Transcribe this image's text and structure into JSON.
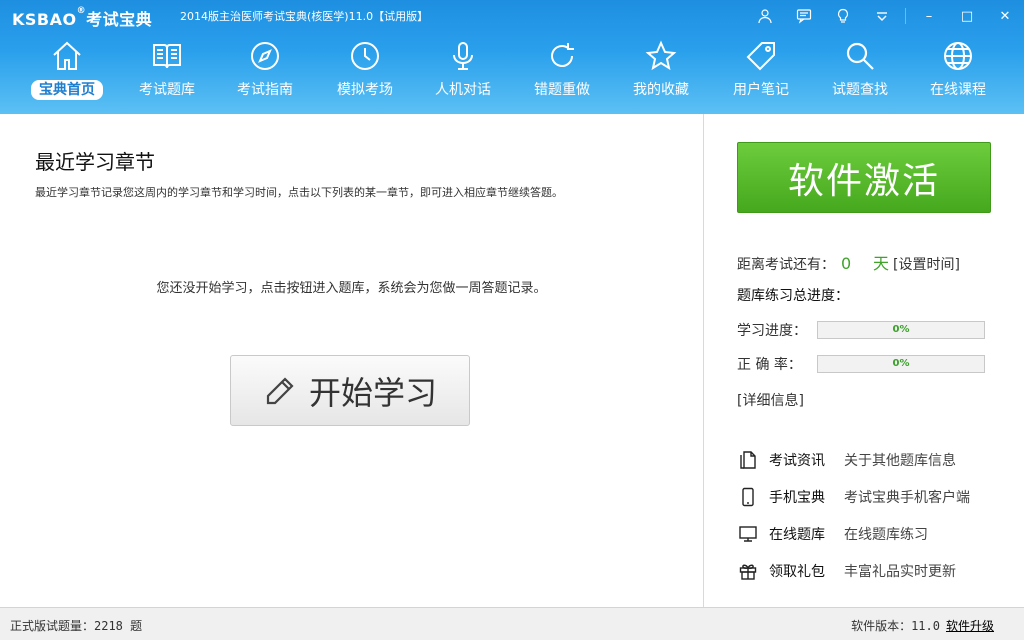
{
  "titlebar": {
    "logo_text": "KSBAO",
    "logo_reg": "®",
    "logo_cn": "考试宝典",
    "app_title": "2014版主治医师考试宝典(核医学)11.0【试用版】",
    "icons": [
      "user-icon",
      "message-icon",
      "lightbulb-icon",
      "dropdown-icon"
    ],
    "minimize": "–",
    "maximize": "□",
    "close": "✕"
  },
  "nav": {
    "items": [
      {
        "label": "宝典首页",
        "icon": "home-icon",
        "active": true
      },
      {
        "label": "考试题库",
        "icon": "book-icon"
      },
      {
        "label": "考试指南",
        "icon": "compass-icon"
      },
      {
        "label": "模拟考场",
        "icon": "clock-icon"
      },
      {
        "label": "人机对话",
        "icon": "microphone-icon"
      },
      {
        "label": "错题重做",
        "icon": "refresh-icon"
      },
      {
        "label": "我的收藏",
        "icon": "star-icon"
      },
      {
        "label": "用户笔记",
        "icon": "tag-icon"
      },
      {
        "label": "试题查找",
        "icon": "search-icon"
      },
      {
        "label": "在线课程",
        "icon": "globe-icon"
      }
    ]
  },
  "main": {
    "title": "最近学习章节",
    "description": "最近学习章节记录您这周内的学习章节和学习时间，点击以下列表的某一章节，即可进入相应章节继续答题。",
    "empty_message": "您还没开始学习，点击按钮进入题库，系统会为您做一周答题记录。",
    "start_button": "开始学习"
  },
  "side": {
    "activate_button": "软件激活",
    "countdown_label": "距离考试还有：",
    "countdown_value": "0",
    "countdown_unit": "天",
    "set_time_link": "[设置时间]",
    "overall_label": "题库练习总进度：",
    "study_progress_label": "学习进度：",
    "study_progress_value": "0%",
    "study_progress_fraction": 0,
    "accuracy_label": "正 确 率：",
    "accuracy_value": "0%",
    "accuracy_fraction": 0,
    "detail_link": "[详细信息]",
    "links": [
      {
        "name": "考试资讯",
        "desc": "关于其他题库信息",
        "icon": "document-icon"
      },
      {
        "name": "手机宝典",
        "desc": "考试宝典手机客户端",
        "icon": "phone-icon"
      },
      {
        "name": "在线题库",
        "desc": "在线题库练习",
        "icon": "monitor-icon"
      },
      {
        "name": "领取礼包",
        "desc": "丰富礼品实时更新",
        "icon": "gift-icon"
      }
    ]
  },
  "statusbar": {
    "question_count": "正式版试题量：2218 题",
    "version": "软件版本：11.0",
    "upgrade": "软件升级"
  },
  "colors": {
    "header": "#2aa0ec",
    "activate": "#4fb526",
    "progress_text": "#3aa02a"
  }
}
